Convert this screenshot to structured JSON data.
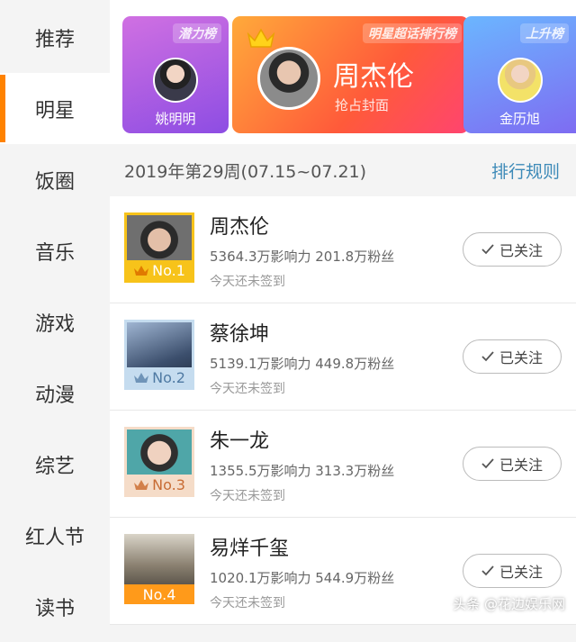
{
  "sidebar": {
    "items": [
      {
        "label": "推荐"
      },
      {
        "label": "明星",
        "active": true
      },
      {
        "label": "饭圈"
      },
      {
        "label": "音乐"
      },
      {
        "label": "游戏"
      },
      {
        "label": "动漫"
      },
      {
        "label": "综艺"
      },
      {
        "label": "红人节"
      },
      {
        "label": "读书"
      }
    ]
  },
  "banner": {
    "left": {
      "tag": "潜力榜",
      "name": "姚明明"
    },
    "middle": {
      "tag": "明星超话排行榜",
      "name": "周杰伦",
      "subtitle": "抢占封面"
    },
    "right": {
      "tag": "上升榜",
      "name": "金历旭"
    }
  },
  "week": {
    "title": "2019年第29周(07.15~07.21)",
    "rules_label": "排行规则"
  },
  "ranking": [
    {
      "rank": "No.1",
      "name": "周杰伦",
      "stats": "5364.3万影响力 201.8万粉丝",
      "checkin": "今天还未签到",
      "follow": "已关注"
    },
    {
      "rank": "No.2",
      "name": "蔡徐坤",
      "stats": "5139.1万影响力 449.8万粉丝",
      "checkin": "今天还未签到",
      "follow": "已关注"
    },
    {
      "rank": "No.3",
      "name": "朱一龙",
      "stats": "1355.5万影响力 313.3万粉丝",
      "checkin": "今天还未签到",
      "follow": "已关注"
    },
    {
      "rank": "No.4",
      "name": "易烊千玺",
      "stats": "1020.1万影响力 544.9万粉丝",
      "checkin": "今天还未签到",
      "follow": "已关注"
    }
  ],
  "watermark": "头条 @花边娱乐网",
  "colors": {
    "accent": "#ff8200",
    "link": "#3d8ab8",
    "rank1": "#f7c31a",
    "rank2": "#c5dcef",
    "rank3": "#f5dcc8",
    "rank4": "#ff9a1a"
  },
  "icons": [
    "crown-icon",
    "check-icon"
  ]
}
